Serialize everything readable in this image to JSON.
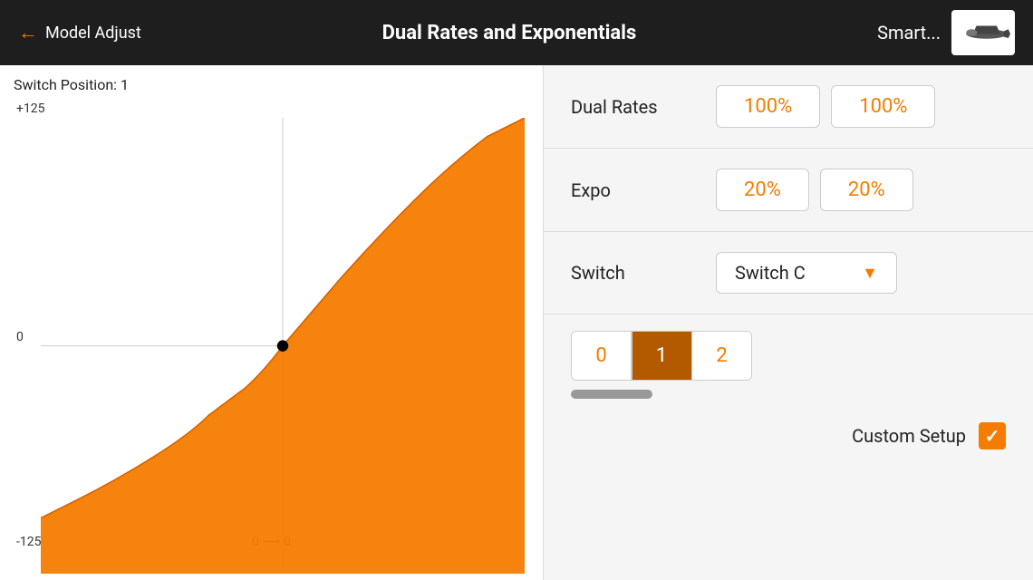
{
  "header": {
    "back_arrow": "←",
    "back_label": "Model Adjust",
    "title": "Dual Rates and Exponentials",
    "smart_label": "Smart...",
    "plane_alt": "Plane icon"
  },
  "chart": {
    "switch_position_label": "Switch Position: 1",
    "y_top": "+125",
    "y_zero": "0",
    "y_bottom": "-125",
    "x_label": "0 ⟶ 0"
  },
  "dual_rates": {
    "label": "Dual Rates",
    "value1": "100%",
    "value2": "100%"
  },
  "expo": {
    "label": "Expo",
    "value1": "20%",
    "value2": "20%"
  },
  "switch_section": {
    "label": "Switch",
    "dropdown_text": "Switch C",
    "dropdown_arrow": "▼"
  },
  "position_selector": {
    "positions": [
      "0",
      "1",
      "2"
    ],
    "active_index": 1
  },
  "custom_setup": {
    "label": "Custom Setup",
    "checked": true
  },
  "colors": {
    "orange": "#f47c00",
    "dark_orange": "#b35900",
    "header_bg": "#1e1e1e",
    "chart_fill": "#f47c00"
  }
}
